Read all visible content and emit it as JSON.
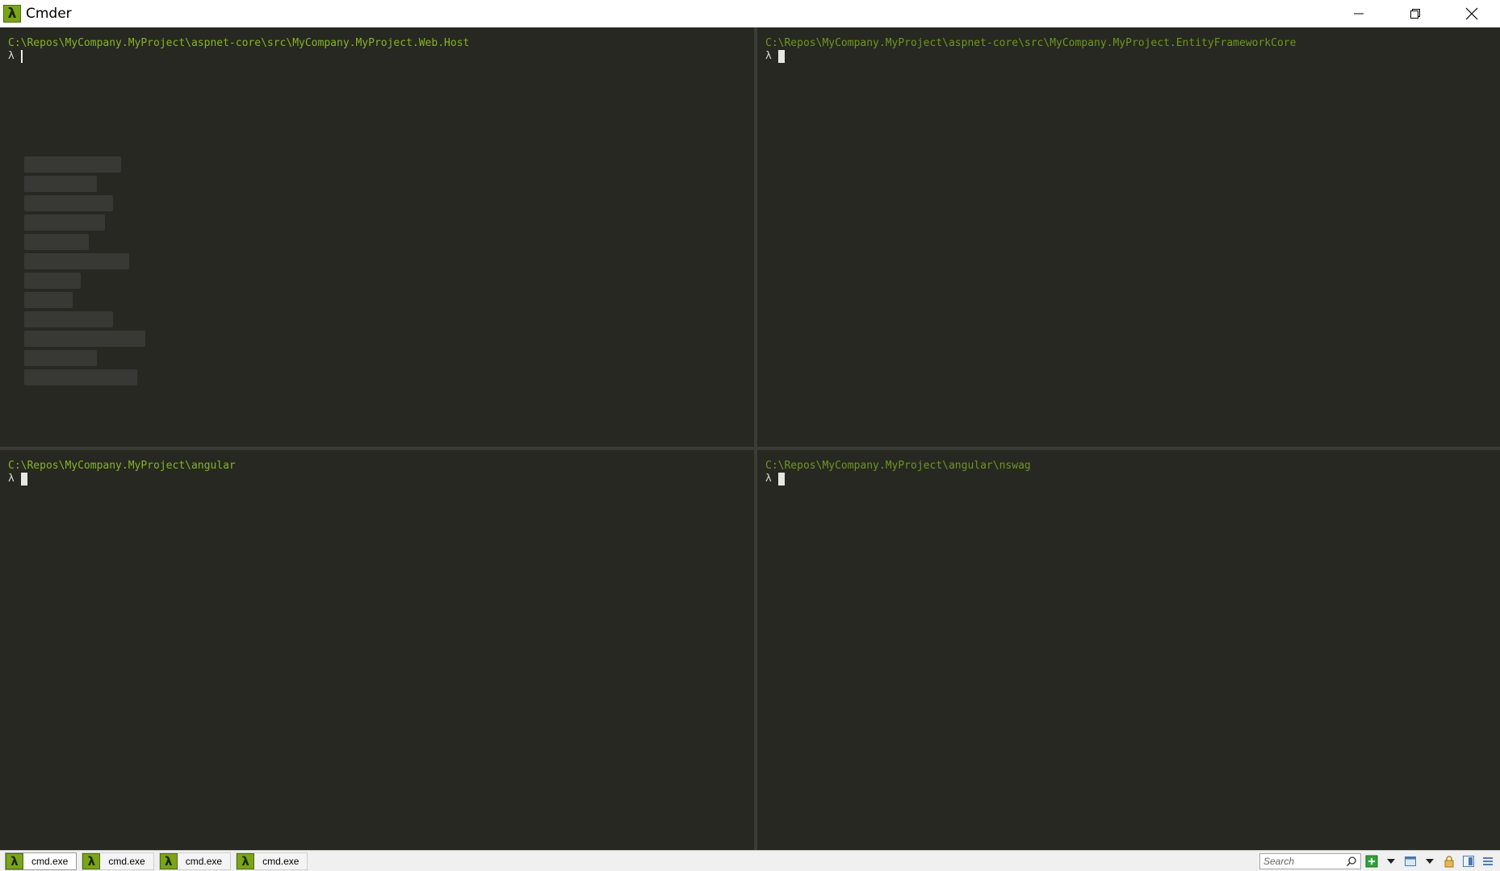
{
  "window": {
    "title": "Cmder"
  },
  "panes": [
    {
      "path": "C:\\Repos\\MyCompany.MyProject\\aspnet-core\\src\\MyCompany.MyProject.Web.Host",
      "prompt": "λ"
    },
    {
      "path": "C:\\Repos\\MyCompany.MyProject\\aspnet-core\\src\\MyCompany.MyProject.EntityFrameworkCore",
      "prompt": "λ"
    },
    {
      "path": "C:\\Repos\\MyCompany.MyProject\\angular",
      "prompt": "λ"
    },
    {
      "path": "C:\\Repos\\MyCompany.MyProject\\angular\\nswag",
      "prompt": "λ"
    }
  ],
  "tabs": [
    {
      "label": "cmd.exe",
      "icon": "λ"
    },
    {
      "label": "cmd.exe",
      "icon": "λ"
    },
    {
      "label": "cmd.exe",
      "icon": "λ"
    },
    {
      "label": "cmd.exe",
      "icon": "λ"
    }
  ],
  "statusbar": {
    "search_placeholder": "Search"
  },
  "colors": {
    "background": "#272822",
    "path": "#86b324",
    "accent": "#7aa419"
  }
}
